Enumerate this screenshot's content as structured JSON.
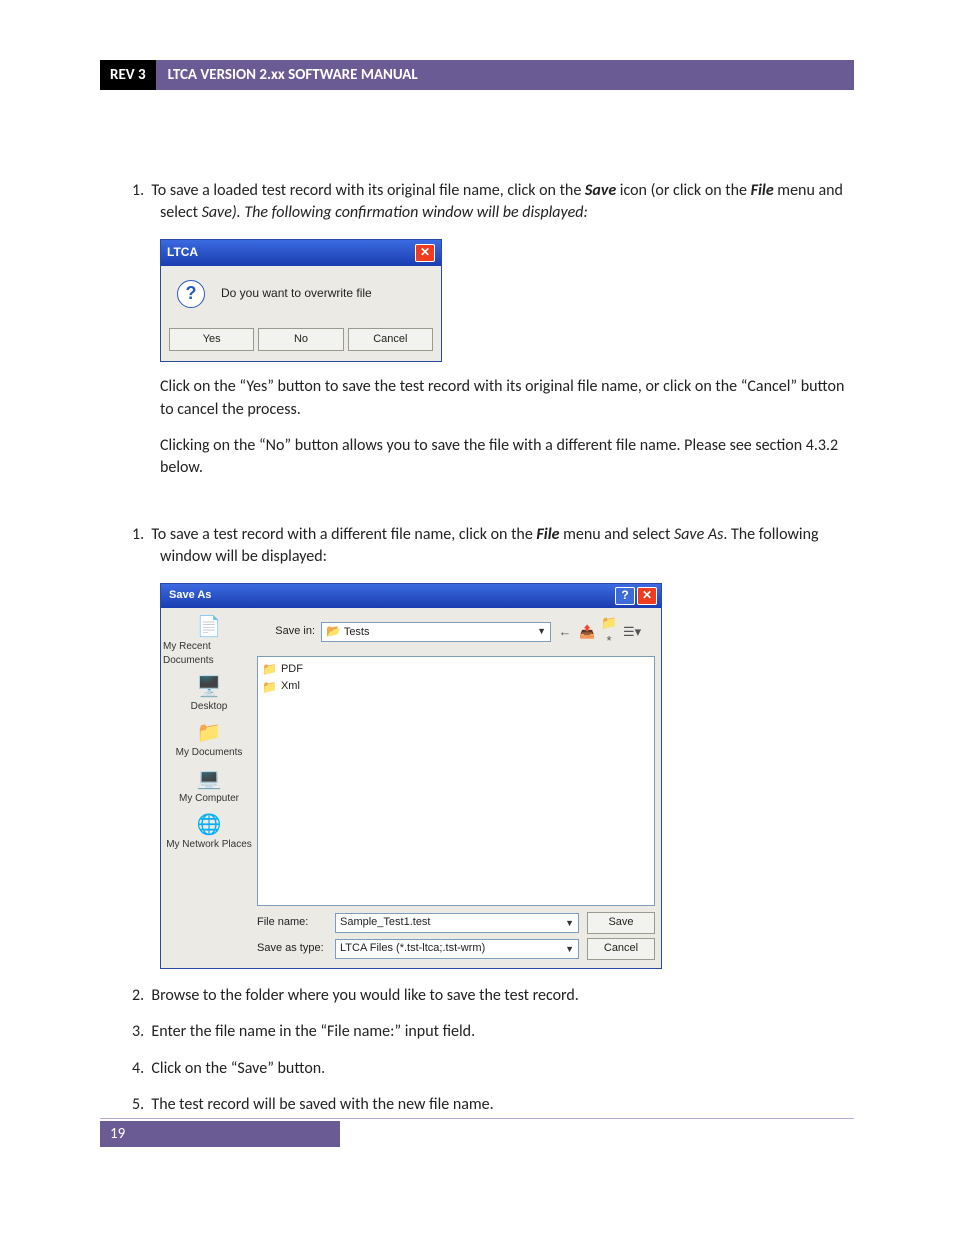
{
  "header": {
    "rev": "REV 3",
    "title": "LTCA VERSION 2.xx SOFTWARE MANUAL"
  },
  "para1": {
    "num": "1.",
    "t1": "To save a loaded test record with its original file name, click on the ",
    "save": "Save",
    "t2": " icon (or click on the ",
    "file": "File",
    "t3": " menu and select ",
    "saveItalic": "Save",
    "t4": "). The following confirmation window will be displayed:"
  },
  "ltca": {
    "title": "LTCA",
    "msg": "Do you want to overwrite file",
    "yes": "Yes",
    "no": "No",
    "cancel": "Cancel"
  },
  "para2": "Click on the “Yes” button to save the test record with its original file name, or click on the “Cancel” button to cancel the process.",
  "para3": "Clicking on the “No” button allows you to save the file with a different file name. Please see section 4.3.2 below.",
  "para4": {
    "num": "1.",
    "t1": "To save a test record with a different file name, click on the ",
    "file": "File",
    "t2": " menu and select ",
    "saveas": "Save As",
    "t3": ". The following window will be displayed:"
  },
  "saveas": {
    "title": "Save As",
    "saveInLabel": "Save in:",
    "saveInValue": "Tests",
    "sidebar": [
      "My Recent Documents",
      "Desktop",
      "My Documents",
      "My Computer",
      "My Network Places"
    ],
    "folders": [
      "PDF",
      "Xml"
    ],
    "filenameLabel": "File name:",
    "filenameValue": "Sample_Test1.test",
    "typeLabel": "Save as type:",
    "typeValue": "LTCA Files (*.tst-ltca;.tst-wrm)",
    "saveBtn": "Save",
    "cancelBtn": "Cancel"
  },
  "steps": {
    "s2": {
      "num": "2.",
      "text": "Browse to the folder where you would like to save the test record."
    },
    "s3": {
      "num": "3.",
      "text": "Enter the file name in the “File name:” input field."
    },
    "s4": {
      "num": "4.",
      "text": "Click on the “Save” button."
    },
    "s5": {
      "num": "5.",
      "text": "The test record will be saved with the new file name."
    }
  },
  "footer": {
    "page": "19"
  }
}
